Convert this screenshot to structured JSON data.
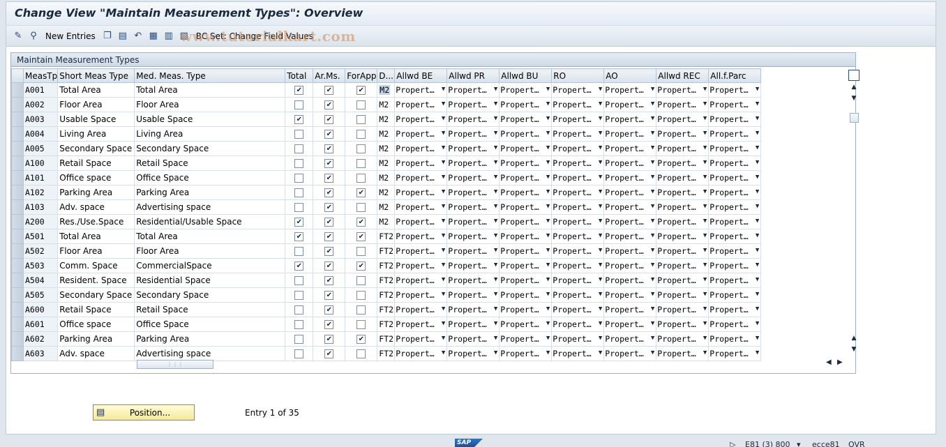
{
  "window": {
    "title": "Change View \"Maintain Measurement Types\": Overview"
  },
  "toolbar": {
    "new_entries": "New Entries",
    "bc_set": "BC Set: Change Field Values",
    "watermark": "www.tutorialkart.com"
  },
  "panel": {
    "title": "Maintain Measurement Types"
  },
  "columns": [
    "MeasTp",
    "Short Meas Type",
    "Med. Meas. Type",
    "Total",
    "Ar.Ms.",
    "ForApp",
    "D...",
    "Allwd BE",
    "Allwd PR",
    "Allwd BU",
    "RO",
    "AO",
    "Allwd REC",
    "All.f.Parc"
  ],
  "dropdown_value": "Propert…",
  "rows": [
    {
      "code": "A001",
      "short": "Total Area",
      "med": "Total Area",
      "total": "✔",
      "arms": "✔",
      "forapp": "✔",
      "unit": "M2"
    },
    {
      "code": "A002",
      "short": "Floor Area",
      "med": "Floor Area",
      "total": "",
      "arms": "✔",
      "forapp": "",
      "unit": "M2"
    },
    {
      "code": "A003",
      "short": "Usable Space",
      "med": "Usable Space",
      "total": "✔",
      "arms": "✔",
      "forapp": "",
      "unit": "M2"
    },
    {
      "code": "A004",
      "short": "Living Area",
      "med": "Living Area",
      "total": "",
      "arms": "✔",
      "forapp": "",
      "unit": "M2"
    },
    {
      "code": "A005",
      "short": "Secondary Space",
      "med": "Secondary Space",
      "total": "",
      "arms": "✔",
      "forapp": "",
      "unit": "M2"
    },
    {
      "code": "A100",
      "short": "Retail Space",
      "med": "Retail Space",
      "total": "",
      "arms": "✔",
      "forapp": "",
      "unit": "M2"
    },
    {
      "code": "A101",
      "short": "Office space",
      "med": "Office Space",
      "total": "",
      "arms": "✔",
      "forapp": "",
      "unit": "M2"
    },
    {
      "code": "A102",
      "short": "Parking Area",
      "med": "Parking Area",
      "total": "",
      "arms": "✔",
      "forapp": "✔",
      "unit": "M2"
    },
    {
      "code": "A103",
      "short": "Adv. space",
      "med": "Advertising space",
      "total": "",
      "arms": "✔",
      "forapp": "",
      "unit": "M2"
    },
    {
      "code": "A200",
      "short": "Res./Use.Space",
      "med": "Residential/Usable Space",
      "total": "✔",
      "arms": "✔",
      "forapp": "✔",
      "unit": "M2"
    },
    {
      "code": "A501",
      "short": "Total Area",
      "med": "Total Area",
      "total": "✔",
      "arms": "✔",
      "forapp": "✔",
      "unit": "FT2"
    },
    {
      "code": "A502",
      "short": "Floor Area",
      "med": "Floor Area",
      "total": "",
      "arms": "✔",
      "forapp": "",
      "unit": "FT2"
    },
    {
      "code": "A503",
      "short": "Comm. Space",
      "med": "CommercialSpace",
      "total": "✔",
      "arms": "✔",
      "forapp": "✔",
      "unit": "FT2"
    },
    {
      "code": "A504",
      "short": "Resident. Space",
      "med": "Residential Space",
      "total": "",
      "arms": "✔",
      "forapp": "",
      "unit": "FT2"
    },
    {
      "code": "A505",
      "short": "Secondary Space",
      "med": "Secondary Space",
      "total": "",
      "arms": "✔",
      "forapp": "",
      "unit": "FT2"
    },
    {
      "code": "A600",
      "short": "Retail Space",
      "med": "Retail Space",
      "total": "",
      "arms": "✔",
      "forapp": "",
      "unit": "FT2"
    },
    {
      "code": "A601",
      "short": "Office space",
      "med": "Office Space",
      "total": "",
      "arms": "✔",
      "forapp": "",
      "unit": "FT2"
    },
    {
      "code": "A602",
      "short": "Parking Area",
      "med": "Parking Area",
      "total": "",
      "arms": "✔",
      "forapp": "✔",
      "unit": "FT2"
    },
    {
      "code": "A603",
      "short": "Adv. space",
      "med": "Advertising space",
      "total": "",
      "arms": "✔",
      "forapp": "",
      "unit": "FT2"
    }
  ],
  "footer": {
    "position_label": "Position...",
    "entry_text": "Entry 1 of 35"
  },
  "statusbar": {
    "logo": "SAP",
    "system": "E81 (3) 800",
    "user": "ecce81",
    "mode": "OVR"
  }
}
